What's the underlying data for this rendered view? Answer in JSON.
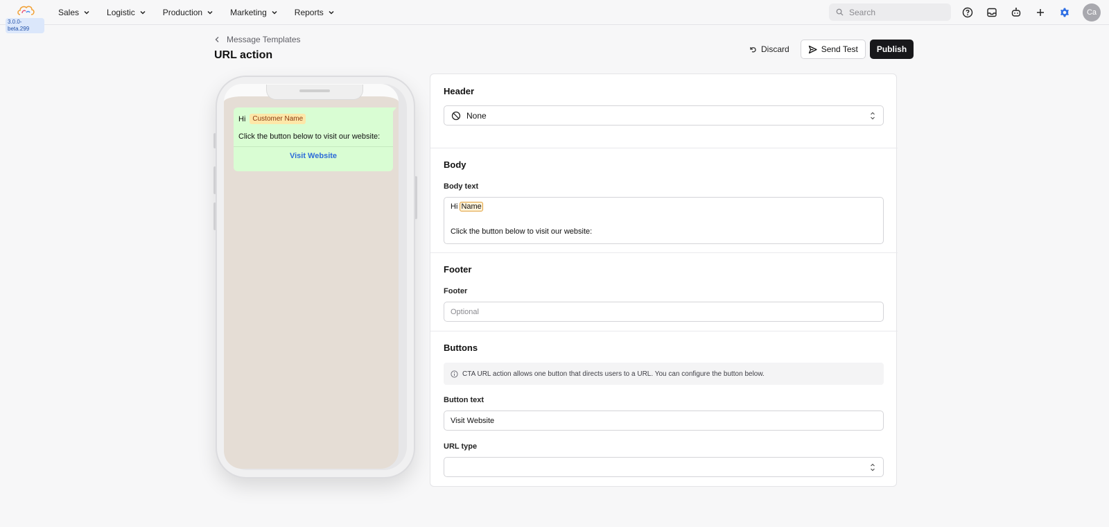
{
  "app": {
    "version": "3.0.0-beta.299"
  },
  "nav": {
    "items": [
      {
        "label": "Sales"
      },
      {
        "label": "Logistic"
      },
      {
        "label": "Production"
      },
      {
        "label": "Marketing"
      },
      {
        "label": "Reports"
      }
    ],
    "search_placeholder": "Search",
    "avatar_initials": "Ca",
    "settings_active_color": "#2f6fe4"
  },
  "page": {
    "breadcrumb": "Message Templates",
    "title": "URL action",
    "discard_label": "Discard",
    "send_test_label": "Send Test",
    "publish_label": "Publish"
  },
  "preview": {
    "greeting": "Hi",
    "variable_chip": "Customer Name",
    "body_line": "Click the button below to visit our website:",
    "cta_label": "Visit Website"
  },
  "editor": {
    "header": {
      "title": "Header",
      "type_value": "None"
    },
    "body": {
      "title": "Body",
      "text_label": "Body text",
      "line1_prefix": "Hi",
      "line1_variable": "Name",
      "line2": "Click the button below to visit our website:"
    },
    "footer": {
      "title": "Footer",
      "label": "Footer",
      "placeholder": "Optional",
      "value": ""
    },
    "buttons": {
      "title": "Buttons",
      "info": "CTA URL action allows one button that directs users to a URL. You can configure the button below.",
      "button_text_label": "Button text",
      "button_text_value": "Visit Website",
      "url_type_label": "URL type",
      "url_type_value": ""
    }
  }
}
